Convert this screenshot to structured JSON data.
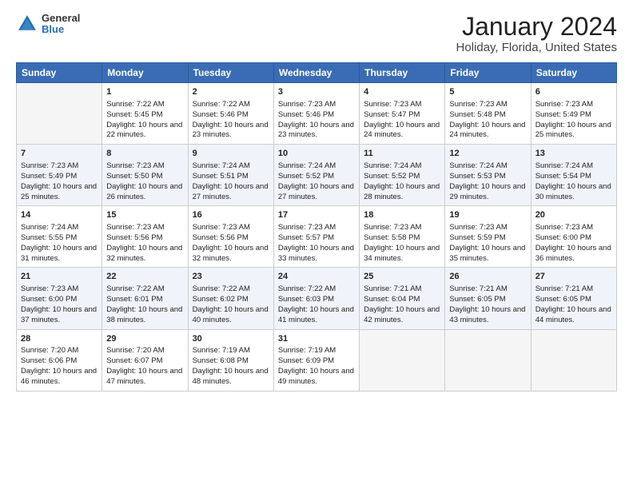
{
  "header": {
    "logo_general": "General",
    "logo_blue": "Blue",
    "title": "January 2024",
    "subtitle": "Holiday, Florida, United States"
  },
  "days_of_week": [
    "Sunday",
    "Monday",
    "Tuesday",
    "Wednesday",
    "Thursday",
    "Friday",
    "Saturday"
  ],
  "weeks": [
    [
      {
        "day": "",
        "sunrise": "",
        "sunset": "",
        "daylight": "",
        "empty": true
      },
      {
        "day": "1",
        "sunrise": "Sunrise: 7:22 AM",
        "sunset": "Sunset: 5:45 PM",
        "daylight": "Daylight: 10 hours and 22 minutes."
      },
      {
        "day": "2",
        "sunrise": "Sunrise: 7:22 AM",
        "sunset": "Sunset: 5:46 PM",
        "daylight": "Daylight: 10 hours and 23 minutes."
      },
      {
        "day": "3",
        "sunrise": "Sunrise: 7:23 AM",
        "sunset": "Sunset: 5:46 PM",
        "daylight": "Daylight: 10 hours and 23 minutes."
      },
      {
        "day": "4",
        "sunrise": "Sunrise: 7:23 AM",
        "sunset": "Sunset: 5:47 PM",
        "daylight": "Daylight: 10 hours and 24 minutes."
      },
      {
        "day": "5",
        "sunrise": "Sunrise: 7:23 AM",
        "sunset": "Sunset: 5:48 PM",
        "daylight": "Daylight: 10 hours and 24 minutes."
      },
      {
        "day": "6",
        "sunrise": "Sunrise: 7:23 AM",
        "sunset": "Sunset: 5:49 PM",
        "daylight": "Daylight: 10 hours and 25 minutes."
      }
    ],
    [
      {
        "day": "7",
        "sunrise": "Sunrise: 7:23 AM",
        "sunset": "Sunset: 5:49 PM",
        "daylight": "Daylight: 10 hours and 25 minutes."
      },
      {
        "day": "8",
        "sunrise": "Sunrise: 7:23 AM",
        "sunset": "Sunset: 5:50 PM",
        "daylight": "Daylight: 10 hours and 26 minutes."
      },
      {
        "day": "9",
        "sunrise": "Sunrise: 7:24 AM",
        "sunset": "Sunset: 5:51 PM",
        "daylight": "Daylight: 10 hours and 27 minutes."
      },
      {
        "day": "10",
        "sunrise": "Sunrise: 7:24 AM",
        "sunset": "Sunset: 5:52 PM",
        "daylight": "Daylight: 10 hours and 27 minutes."
      },
      {
        "day": "11",
        "sunrise": "Sunrise: 7:24 AM",
        "sunset": "Sunset: 5:52 PM",
        "daylight": "Daylight: 10 hours and 28 minutes."
      },
      {
        "day": "12",
        "sunrise": "Sunrise: 7:24 AM",
        "sunset": "Sunset: 5:53 PM",
        "daylight": "Daylight: 10 hours and 29 minutes."
      },
      {
        "day": "13",
        "sunrise": "Sunrise: 7:24 AM",
        "sunset": "Sunset: 5:54 PM",
        "daylight": "Daylight: 10 hours and 30 minutes."
      }
    ],
    [
      {
        "day": "14",
        "sunrise": "Sunrise: 7:24 AM",
        "sunset": "Sunset: 5:55 PM",
        "daylight": "Daylight: 10 hours and 31 minutes."
      },
      {
        "day": "15",
        "sunrise": "Sunrise: 7:23 AM",
        "sunset": "Sunset: 5:56 PM",
        "daylight": "Daylight: 10 hours and 32 minutes."
      },
      {
        "day": "16",
        "sunrise": "Sunrise: 7:23 AM",
        "sunset": "Sunset: 5:56 PM",
        "daylight": "Daylight: 10 hours and 32 minutes."
      },
      {
        "day": "17",
        "sunrise": "Sunrise: 7:23 AM",
        "sunset": "Sunset: 5:57 PM",
        "daylight": "Daylight: 10 hours and 33 minutes."
      },
      {
        "day": "18",
        "sunrise": "Sunrise: 7:23 AM",
        "sunset": "Sunset: 5:58 PM",
        "daylight": "Daylight: 10 hours and 34 minutes."
      },
      {
        "day": "19",
        "sunrise": "Sunrise: 7:23 AM",
        "sunset": "Sunset: 5:59 PM",
        "daylight": "Daylight: 10 hours and 35 minutes."
      },
      {
        "day": "20",
        "sunrise": "Sunrise: 7:23 AM",
        "sunset": "Sunset: 6:00 PM",
        "daylight": "Daylight: 10 hours and 36 minutes."
      }
    ],
    [
      {
        "day": "21",
        "sunrise": "Sunrise: 7:23 AM",
        "sunset": "Sunset: 6:00 PM",
        "daylight": "Daylight: 10 hours and 37 minutes."
      },
      {
        "day": "22",
        "sunrise": "Sunrise: 7:22 AM",
        "sunset": "Sunset: 6:01 PM",
        "daylight": "Daylight: 10 hours and 38 minutes."
      },
      {
        "day": "23",
        "sunrise": "Sunrise: 7:22 AM",
        "sunset": "Sunset: 6:02 PM",
        "daylight": "Daylight: 10 hours and 40 minutes."
      },
      {
        "day": "24",
        "sunrise": "Sunrise: 7:22 AM",
        "sunset": "Sunset: 6:03 PM",
        "daylight": "Daylight: 10 hours and 41 minutes."
      },
      {
        "day": "25",
        "sunrise": "Sunrise: 7:21 AM",
        "sunset": "Sunset: 6:04 PM",
        "daylight": "Daylight: 10 hours and 42 minutes."
      },
      {
        "day": "26",
        "sunrise": "Sunrise: 7:21 AM",
        "sunset": "Sunset: 6:05 PM",
        "daylight": "Daylight: 10 hours and 43 minutes."
      },
      {
        "day": "27",
        "sunrise": "Sunrise: 7:21 AM",
        "sunset": "Sunset: 6:05 PM",
        "daylight": "Daylight: 10 hours and 44 minutes."
      }
    ],
    [
      {
        "day": "28",
        "sunrise": "Sunrise: 7:20 AM",
        "sunset": "Sunset: 6:06 PM",
        "daylight": "Daylight: 10 hours and 46 minutes."
      },
      {
        "day": "29",
        "sunrise": "Sunrise: 7:20 AM",
        "sunset": "Sunset: 6:07 PM",
        "daylight": "Daylight: 10 hours and 47 minutes."
      },
      {
        "day": "30",
        "sunrise": "Sunrise: 7:19 AM",
        "sunset": "Sunset: 6:08 PM",
        "daylight": "Daylight: 10 hours and 48 minutes."
      },
      {
        "day": "31",
        "sunrise": "Sunrise: 7:19 AM",
        "sunset": "Sunset: 6:09 PM",
        "daylight": "Daylight: 10 hours and 49 minutes."
      },
      {
        "day": "",
        "sunrise": "",
        "sunset": "",
        "daylight": "",
        "empty": true
      },
      {
        "day": "",
        "sunrise": "",
        "sunset": "",
        "daylight": "",
        "empty": true
      },
      {
        "day": "",
        "sunrise": "",
        "sunset": "",
        "daylight": "",
        "empty": true
      }
    ]
  ]
}
